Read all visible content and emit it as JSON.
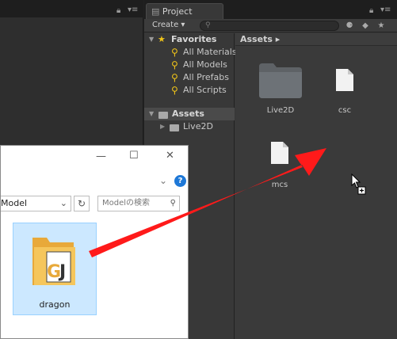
{
  "project_window": {
    "tab_label": "Project",
    "create_label": "Create ▾",
    "search_placeholder": "",
    "favorites": {
      "label": "Favorites",
      "items": [
        "All Materials",
        "All Models",
        "All Prefabs",
        "All Scripts"
      ]
    },
    "tree_assets_label": "Assets",
    "tree_children": [
      "Live2D"
    ],
    "breadcrumb": "Assets ▸",
    "assets": [
      {
        "name": "Live2D",
        "icon": "folder-icon"
      },
      {
        "name": "csc",
        "icon": "file-icon"
      },
      {
        "name": "mcs",
        "icon": "file-icon"
      }
    ]
  },
  "explorer_window": {
    "address_value": "Model",
    "search_placeholder": "Modelの検索",
    "file": {
      "name": "dragon",
      "icon": "dragon-app-icon"
    }
  },
  "colors": {
    "arrow": "#ff1a1a",
    "favorites_star": "#f0c419",
    "selection": "#cce8ff",
    "help_icon": "#1e78d7"
  }
}
